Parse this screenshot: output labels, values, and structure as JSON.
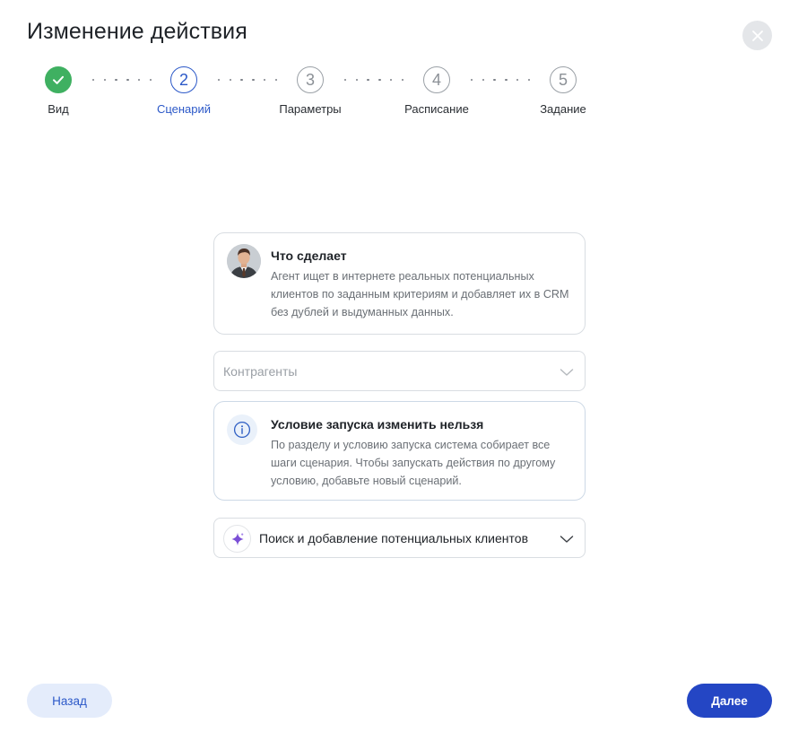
{
  "dialog": {
    "title": "Изменение действия"
  },
  "close": {
    "icon": "close-icon"
  },
  "stepper": {
    "steps": [
      {
        "number": "1",
        "label": "Вид",
        "state": "done"
      },
      {
        "number": "2",
        "label": "Сценарий",
        "state": "active"
      },
      {
        "number": "3",
        "label": "Параметры",
        "state": "pending"
      },
      {
        "number": "4",
        "label": "Расписание",
        "state": "pending"
      },
      {
        "number": "5",
        "label": "Задание",
        "state": "pending"
      }
    ],
    "colors": {
      "done": "#3fb061",
      "active": "#2b58c8",
      "pending": "#9aa0a6"
    }
  },
  "agent_card": {
    "title": "Что сделает",
    "text": "Агент ищет в интернете реальных потенциальных клиентов по заданным критериям и добавляет их в CRM без дублей и выдуманных данных."
  },
  "section_select": {
    "placeholder": "Контрагенты"
  },
  "info_card": {
    "title": "Условие запуска изменить нельзя",
    "text": "По разделу и условию запуска система собирает все шаги сценария. Чтобы запускать действия по другому условию, добавьте новый сценарий."
  },
  "scenario_select": {
    "value": "Поиск и добавление потенциальных клиентов",
    "icon": "sparkle-icon",
    "icon_color": "#7b4fd6"
  },
  "buttons": {
    "back": "Назад",
    "next": "Далее",
    "primary_color": "#2446c4"
  }
}
